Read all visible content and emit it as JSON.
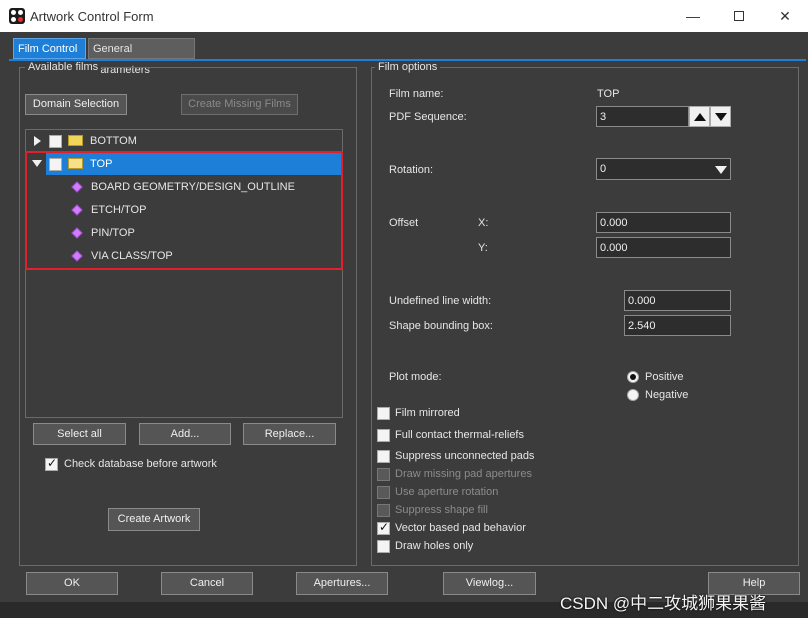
{
  "window": {
    "title": "Artwork Control Form",
    "minimize_icon": "minimize-icon",
    "maximize_icon": "maximize-icon",
    "close_icon": "close-icon"
  },
  "tabs": [
    {
      "label": "Film Control",
      "active": true
    },
    {
      "label": "General Parameters",
      "active": false
    }
  ],
  "available_films": {
    "title": "Available films",
    "domain_selection_label": "Domain Selection",
    "create_missing_label": "Create Missing Films",
    "tree": [
      {
        "label": "BOTTOM",
        "expanded": false,
        "checked": false
      },
      {
        "label": "TOP",
        "expanded": true,
        "checked": false,
        "selected": true,
        "children": [
          "BOARD GEOMETRY/DESIGN_OUTLINE",
          "ETCH/TOP",
          "PIN/TOP",
          "VIA CLASS/TOP"
        ]
      }
    ],
    "select_all_label": "Select all",
    "add_label": "Add...",
    "replace_label": "Replace...",
    "check_db_label": "Check database before artwork",
    "check_db_checked": true,
    "create_artwork_label": "Create Artwork"
  },
  "film_options": {
    "title": "Film options",
    "film_name_label": "Film name:",
    "film_name_value": "TOP",
    "pdf_sequence_label": "PDF Sequence:",
    "pdf_sequence_value": "3",
    "rotation_label": "Rotation:",
    "rotation_value": "0",
    "offset_label": "Offset",
    "x_label": "X:",
    "x_value": "0.000",
    "y_label": "Y:",
    "y_value": "0.000",
    "undefined_line_width_label": "Undefined line width:",
    "undefined_line_width_value": "0.000",
    "shape_bounding_box_label": "Shape bounding box:",
    "shape_bounding_box_value": "2.540",
    "plot_mode_label": "Plot mode:",
    "positive_label": "Positive",
    "negative_label": "Negative",
    "plot_mode_value": "Positive",
    "checkboxes": [
      {
        "label": "Film mirrored",
        "checked": false,
        "enabled": true
      },
      {
        "label": "Full contact thermal-reliefs",
        "checked": false,
        "enabled": true
      },
      {
        "label": "Suppress unconnected pads",
        "checked": false,
        "enabled": true
      },
      {
        "label": "Draw missing pad apertures",
        "checked": false,
        "enabled": false
      },
      {
        "label": "Use aperture rotation",
        "checked": false,
        "enabled": false
      },
      {
        "label": "Suppress shape fill",
        "checked": false,
        "enabled": false
      },
      {
        "label": "Vector based pad behavior",
        "checked": true,
        "enabled": true
      },
      {
        "label": "Draw holes only",
        "checked": false,
        "enabled": true
      }
    ]
  },
  "footer": {
    "ok_label": "OK",
    "cancel_label": "Cancel",
    "apertures_label": "Apertures...",
    "viewlog_label": "Viewlog...",
    "help_label": "Help"
  },
  "watermark": "CSDN @中二攻城狮果果酱",
  "colors": {
    "accent": "#1d7fd8",
    "highlight_border": "#e0202a",
    "selection": "#1d7fd8"
  }
}
